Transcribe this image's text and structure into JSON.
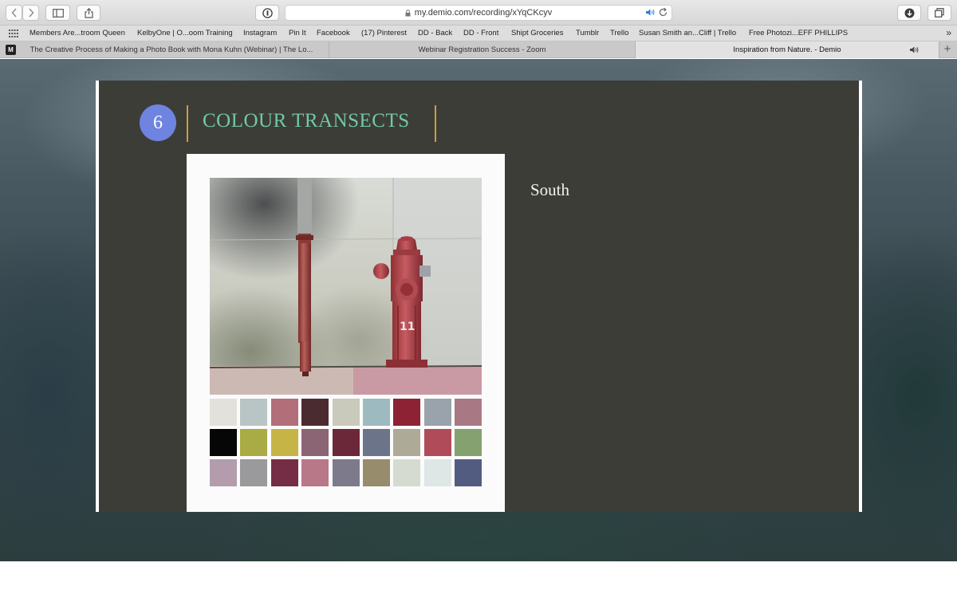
{
  "browser": {
    "url": "my.demio.com/recording/xYqCKcyv",
    "bookmarks": [
      "Members Are...troom Queen",
      "KelbyOne | O...oom Training",
      "Instagram",
      "Pin It",
      "Facebook",
      "(17) Pinterest",
      "DD - Back",
      "DD - Front",
      "Shipt Groceries",
      "Tumblr",
      "Trello",
      "Susan Smith an...Cliff | Trello",
      "Free Photozi...EFF PHILLIPS"
    ],
    "tabs": [
      {
        "label": "The Creative Process of Making a Photo Book with Mona Kuhn (Webinar) | The Lo...",
        "active": false
      },
      {
        "label": "Webinar Registration Success - Zoom",
        "active": false
      },
      {
        "label": "Inspiration from Nature. - Demio",
        "active": true
      }
    ],
    "icons": [
      "back-icon",
      "forward-icon",
      "sidebar-icon",
      "share-icon",
      "privacy-icon",
      "lock-icon",
      "speaker-icon",
      "reload-icon",
      "download-icon",
      "tabs-overview-icon",
      "grid-icon",
      "chevron-right-icon",
      "plus-icon"
    ]
  },
  "slide": {
    "number": "6",
    "title": "COLOUR TRANSECTS",
    "direction": "South",
    "accent_colors": {
      "circle": "#6f84e0",
      "title": "#6fc9a8",
      "divider": "#c9a13a",
      "background": "#3d3d37"
    },
    "swatches": [
      "#e2e1db",
      "#b9c4c4",
      "#b26e79",
      "#4a2c30",
      "#c9cabb",
      "#9dbac0",
      "#8c2234",
      "#9aa3ab",
      "#a87984",
      "#060606",
      "#a9ab45",
      "#c6b446",
      "#8c6574",
      "#6a2839",
      "#6b7488",
      "#aeaa98",
      "#b04b5a",
      "#85a170",
      "#b39dad",
      "#9a9a9c",
      "#752d45",
      "#b97888",
      "#7d7a8c",
      "#978c6c",
      "#d6dbd2",
      "#dfe7e6",
      "#525c80"
    ]
  }
}
